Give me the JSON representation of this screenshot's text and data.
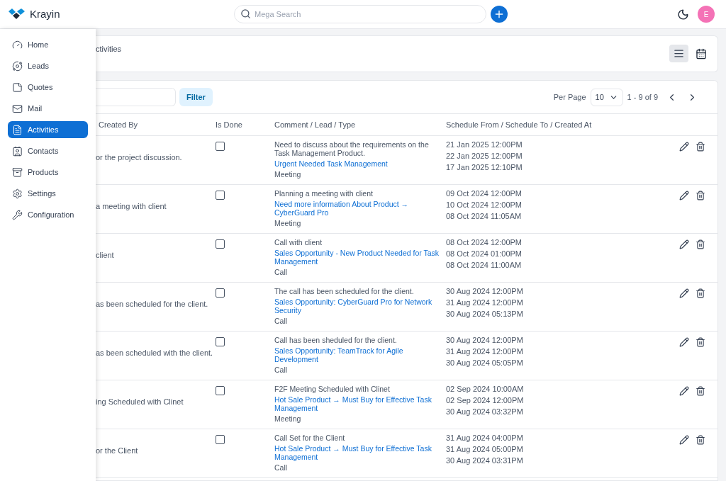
{
  "header": {
    "brand": "Krayin",
    "search": {
      "placeholder": "Mega Search"
    },
    "avatar": "E"
  },
  "sidebar": {
    "items": [
      {
        "label": "Home",
        "selected": false
      },
      {
        "label": "Leads",
        "selected": false
      },
      {
        "label": "Quotes",
        "selected": false
      },
      {
        "label": "Mail",
        "selected": false
      },
      {
        "label": "Activities",
        "selected": true
      },
      {
        "label": "Contacts",
        "selected": false
      },
      {
        "label": "Products",
        "selected": false
      },
      {
        "label": "Settings",
        "selected": false
      },
      {
        "label": "Configuration",
        "selected": false
      }
    ]
  },
  "page": {
    "title": "ctivities",
    "views": [
      {
        "kind": "list",
        "selected": true
      },
      {
        "kind": "calendar",
        "selected": false
      }
    ]
  },
  "toolbar": {
    "filter": "Filter",
    "per_page_label": "Per Page",
    "per_page": "10",
    "range": "1 - 9 of 9"
  },
  "table": {
    "columns": [
      "Created By",
      "Is Done",
      "Comment / Lead / Type",
      "Schedule From / Schedule To / Created At"
    ],
    "rows": [
      {
        "column_1": "or the project discussion.",
        "done": false,
        "comment": "Need to discuss about the requirements on the Task Management Product.",
        "lead": "Urgent Needed Task Management",
        "type": "Meeting",
        "dates": [
          "21 Jan 2025 12:00PM",
          "22 Jan 2025 12:00PM",
          "17 Jan 2025 12:10PM"
        ]
      },
      {
        "column_1": "a meeting with client",
        "done": false,
        "comment": "Planning a meeting with client",
        "lead": "Need more information About Product → CyberGuard Pro",
        "type": "Meeting",
        "dates": [
          "09 Oct 2024 12:00PM",
          "10 Oct 2024 12:00PM",
          "08 Oct 2024 11:05AM"
        ]
      },
      {
        "column_1": "client",
        "done": false,
        "comment": "Call with client",
        "lead": "Sales Opportunity - New Product Needed for Task Management",
        "type": "Call",
        "dates": [
          "08 Oct 2024 12:00PM",
          "08 Oct 2024 01:00PM",
          "08 Oct 2024 11:00AM"
        ]
      },
      {
        "column_1": "as been scheduled for the client.",
        "done": false,
        "comment": "The call has been scheduled for the client.",
        "lead": "Sales Opportunity: CyberGuard Pro for Network Security",
        "type": "Call",
        "dates": [
          "30 Aug 2024 12:00PM",
          "31 Aug 2024 12:00PM",
          "30 Aug 2024 05:13PM"
        ]
      },
      {
        "column_1": "as been scheduled with the client.",
        "done": false,
        "comment": "Call has been sheduled for the client.",
        "lead": "Sales Opportunity: TeamTrack for Agile Development",
        "type": "Call",
        "dates": [
          "30 Aug 2024 12:00PM",
          "31 Aug 2024 12:00PM",
          "30 Aug 2024 05:05PM"
        ]
      },
      {
        "column_1": "ing Scheduled with Clinet",
        "done": false,
        "comment": "F2F Meeting Scheduled with Clinet",
        "lead": "Hot Sale Product → Must Buy for Effective Task Management",
        "type": "Meeting",
        "dates": [
          "02 Sep 2024 10:00AM",
          "02 Sep 2024 12:00PM",
          "30 Aug 2024 03:32PM"
        ]
      },
      {
        "column_1": "or the Client",
        "done": false,
        "comment": "Call Set for the Client",
        "lead": "Hot Sale Product → Must Buy for Effective Task Management",
        "type": "Call",
        "dates": [
          "31 Aug 2024 04:00PM",
          "31 Aug 2024 05:00PM",
          "30 Aug 2024 03:31PM"
        ]
      }
    ]
  }
}
